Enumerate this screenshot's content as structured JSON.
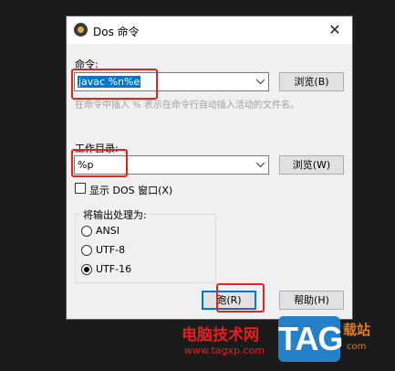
{
  "dialog": {
    "title": "Dos 命令",
    "close_glyph": "✕",
    "command_label": "命令:",
    "command_value": "javac %n%e",
    "browse1_label": "浏览(B)",
    "hint": "在命令中插入 % 表示在命令行自动插入活动的文件名。",
    "workdir_label": "工作目录:",
    "workdir_value": "%p",
    "browse2_label": "浏览(W)",
    "show_dos_label": "显示 DOS 窗口(X)",
    "show_dos_checked": false,
    "output_group_label": "将输出处理为:",
    "encoding_options": [
      "ANSI",
      "UTF-8",
      "UTF-16"
    ],
    "encoding_selected": "UTF-16",
    "run_label": "跑(R)",
    "help_label": "帮助(H)"
  },
  "watermark": {
    "site_name": "电脑技术网",
    "url": "www.tagxp.com",
    "logo_text": "TAG",
    "side_text": "载站",
    "side_sub": "com"
  },
  "colors": {
    "highlight": "#e4231f",
    "selection": "#0078d7",
    "logo_blue": "#2481c9"
  }
}
